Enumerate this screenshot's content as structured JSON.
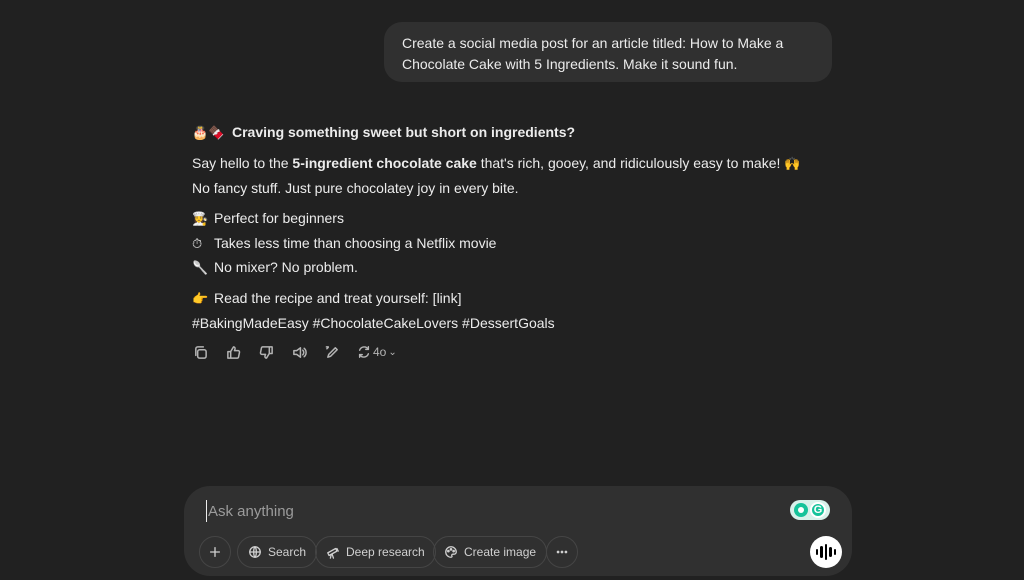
{
  "user_message": {
    "line1": "Create a social media post for an article titled: How to Make a",
    "line2": "Chocolate Cake with 5 Ingredients. Make it sound fun."
  },
  "assistant": {
    "heading_emoji": "🎂🍫",
    "heading": "Craving something sweet but short on ingredients?",
    "p1_prefix": "Say hello to the ",
    "p1_bold": "5-ingredient chocolate cake",
    "p1_suffix": " that's rich, gooey, and ridiculously easy to make!",
    "p1_emoji": "🙌",
    "p2": "No fancy stuff. Just pure chocolatey joy in every bite.",
    "bullets": [
      {
        "emoji": "👩‍🍳",
        "text": "Perfect for beginners"
      },
      {
        "emoji": "⏱",
        "text": "Takes less time than choosing a Netflix movie"
      },
      {
        "emoji": "🥄",
        "text": "No mixer? No problem."
      }
    ],
    "cta_emoji": "👉",
    "cta": "Read the recipe and treat yourself: [link]",
    "hashtags": "#BakingMadeEasy #ChocolateCakeLovers #DessertGoals"
  },
  "actions": {
    "icons": [
      "copy-icon",
      "thumbs-up-icon",
      "thumbs-down-icon",
      "speaker-icon",
      "edit-icon",
      "regenerate-icon"
    ],
    "model_label": "4o"
  },
  "composer": {
    "placeholder": "Ask anything",
    "buttons": {
      "search": "Search",
      "deep_research": "Deep research",
      "create_image": "Create image"
    }
  },
  "colors": {
    "background": "#212121",
    "bubble": "#303030",
    "text": "#ececec",
    "grammarly": "#15c39a"
  }
}
